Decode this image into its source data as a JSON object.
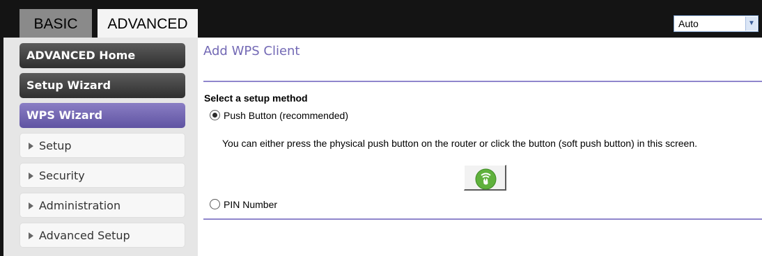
{
  "tabs": {
    "basic": "BASIC",
    "advanced": "ADVANCED"
  },
  "language": {
    "selected": "Auto"
  },
  "sidebar": {
    "items": [
      {
        "label": "ADVANCED Home"
      },
      {
        "label": "Setup Wizard"
      },
      {
        "label": "WPS Wizard",
        "active": true
      },
      {
        "label": "Setup"
      },
      {
        "label": "Security"
      },
      {
        "label": "Administration"
      },
      {
        "label": "Advanced Setup"
      }
    ]
  },
  "main": {
    "title": "Add WPS Client",
    "section_label": "Select a setup method",
    "push_button": {
      "label": "Push Button (recommended)",
      "checked": true,
      "description": "You can either press the physical push button on the router or click the button (soft push button) in this screen."
    },
    "pin_number": {
      "label": "PIN Number",
      "checked": false
    },
    "wps_button_icon": "wps-icon"
  },
  "colors": {
    "accent_purple": "#5f53a2",
    "title_purple": "#7369b5",
    "wps_green": "#5fb13c",
    "topbar": "#141414"
  }
}
